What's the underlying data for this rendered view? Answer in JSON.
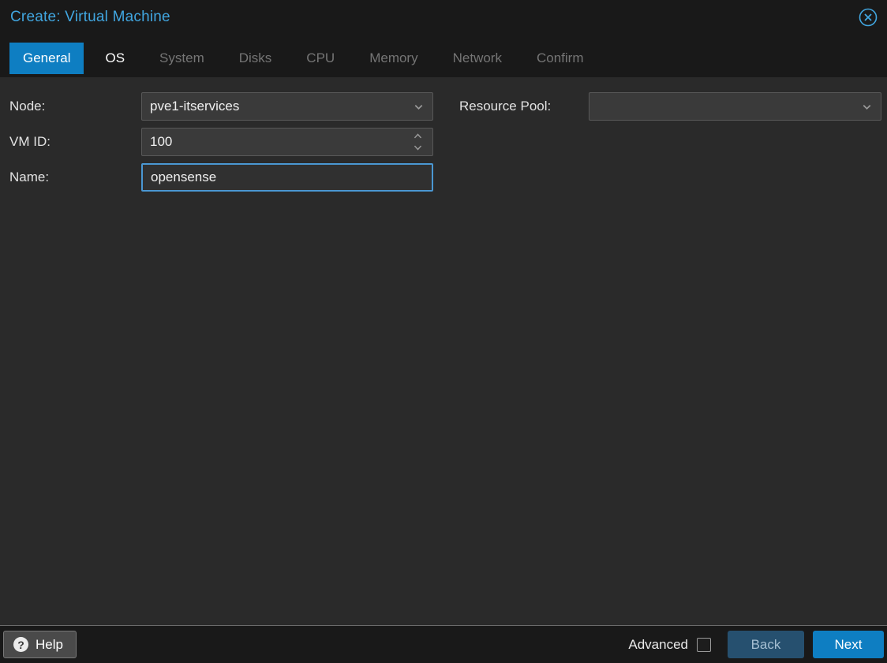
{
  "dialog": {
    "title": "Create: Virtual Machine"
  },
  "tabs": [
    {
      "label": "General",
      "state": "active"
    },
    {
      "label": "OS",
      "state": "enabled"
    },
    {
      "label": "System",
      "state": "disabled"
    },
    {
      "label": "Disks",
      "state": "disabled"
    },
    {
      "label": "CPU",
      "state": "disabled"
    },
    {
      "label": "Memory",
      "state": "disabled"
    },
    {
      "label": "Network",
      "state": "disabled"
    },
    {
      "label": "Confirm",
      "state": "disabled"
    }
  ],
  "form": {
    "node": {
      "label": "Node:",
      "value": "pve1-itservices"
    },
    "vmid": {
      "label": "VM ID:",
      "value": "100"
    },
    "name": {
      "label": "Name:",
      "value": "opensense"
    },
    "resource_pool": {
      "label": "Resource Pool:",
      "value": ""
    }
  },
  "footer": {
    "help_label": "Help",
    "advanced_label": "Advanced",
    "advanced_checked": false,
    "back_label": "Back",
    "next_label": "Next"
  },
  "icons": {
    "close": "close-circle-icon",
    "dropdown": "chevron-down-icon",
    "spinner_up": "spinner-up-icon",
    "spinner_down": "spinner-down-icon",
    "help": "question-circle-icon"
  },
  "colors": {
    "accent_blue": "#0e7ec2",
    "title_blue": "#41a6e0",
    "content_bg": "#2a2a2a",
    "chrome_bg": "#191919"
  }
}
